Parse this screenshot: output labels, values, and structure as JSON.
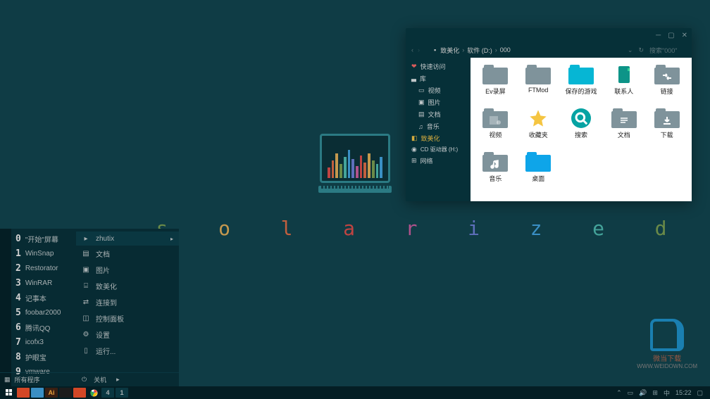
{
  "desktop": {
    "word": [
      {
        "ch": "s",
        "color": "#6a8a48"
      },
      {
        "ch": "o",
        "color": "#c4984e"
      },
      {
        "ch": "l",
        "color": "#c15f3e"
      },
      {
        "ch": "a",
        "color": "#bf4442"
      },
      {
        "ch": "r",
        "color": "#b0528c"
      },
      {
        "ch": "i",
        "color": "#5f6fbb"
      },
      {
        "ch": "z",
        "color": "#3a8fc4"
      },
      {
        "ch": "e",
        "color": "#44a39a"
      },
      {
        "ch": "d",
        "color": "#6a8a48"
      }
    ]
  },
  "startMenu": {
    "left": [
      {
        "num": "0",
        "label": "\"开始\"屏幕"
      },
      {
        "num": "1",
        "label": "WinSnap"
      },
      {
        "num": "2",
        "label": "Restorator"
      },
      {
        "num": "3",
        "label": "WinRAR"
      },
      {
        "num": "4",
        "label": "记事本"
      },
      {
        "num": "5",
        "label": "foobar2000"
      },
      {
        "num": "6",
        "label": "腾讯QQ"
      },
      {
        "num": "7",
        "label": "icofx3"
      },
      {
        "num": "8",
        "label": "护眼宝"
      },
      {
        "num": "9",
        "label": "vmware"
      }
    ],
    "right": [
      {
        "icon": "folder",
        "label": "zhutix",
        "arrow": true
      },
      {
        "icon": "doc",
        "label": "文档"
      },
      {
        "icon": "image",
        "label": "图片"
      },
      {
        "icon": "monitor",
        "label": "致美化"
      },
      {
        "icon": "link",
        "label": "连接到"
      },
      {
        "icon": "panel",
        "label": "控制面板"
      },
      {
        "icon": "gear",
        "label": "设置"
      },
      {
        "icon": "run",
        "label": "运行..."
      }
    ],
    "allPrograms": "所有程序",
    "shutdown": "关机"
  },
  "explorer": {
    "breadcrumb": [
      "致美化",
      "软件 (D:)",
      "000"
    ],
    "searchPlaceholder": "搜索\"000\"",
    "sidebar": {
      "quick": "快速访问",
      "library": "库",
      "libItems": [
        "视频",
        "图片",
        "文档",
        "音乐"
      ],
      "beautify": "致美化",
      "cdDrive": "CD 驱动器 (H:)",
      "network": "网络"
    },
    "items": [
      {
        "label": "Ev录屏",
        "type": "folder"
      },
      {
        "label": "FTMod",
        "type": "folder"
      },
      {
        "label": "保存的游戏",
        "type": "folder-cyan"
      },
      {
        "label": "联系人",
        "type": "contacts"
      },
      {
        "label": "链接",
        "type": "links"
      },
      {
        "label": "视频",
        "type": "video"
      },
      {
        "label": "收藏夹",
        "type": "favorites"
      },
      {
        "label": "搜索",
        "type": "search"
      },
      {
        "label": "文档",
        "type": "docs"
      },
      {
        "label": "下载",
        "type": "downloads"
      },
      {
        "label": "音乐",
        "type": "music"
      },
      {
        "label": "桌面",
        "type": "desktop"
      }
    ]
  },
  "taskbar": {
    "pinned": [
      {
        "name": "start",
        "color": "#ffffff"
      },
      {
        "name": "office",
        "color": "#d34726"
      },
      {
        "name": "app1",
        "color": "#3a8fc4"
      },
      {
        "name": "adobe",
        "color": "#3a1f12",
        "text": "Ai",
        "tc": "#e7a13c"
      },
      {
        "name": "chat",
        "color": "#1c1c1c"
      },
      {
        "name": "browser",
        "color": "#d34726"
      },
      {
        "name": "chrome",
        "color": "#2a2a2a"
      },
      {
        "name": "num4",
        "color": "#0a3741",
        "text": "4",
        "tc": "#a8b0b2"
      },
      {
        "name": "num1",
        "color": "#0a3741",
        "text": "1",
        "tc": "#a8b0b2"
      }
    ],
    "time": "15:22"
  },
  "watermark": {
    "title": "微当下载",
    "url": "WWW.WEIDOWN.COM"
  }
}
